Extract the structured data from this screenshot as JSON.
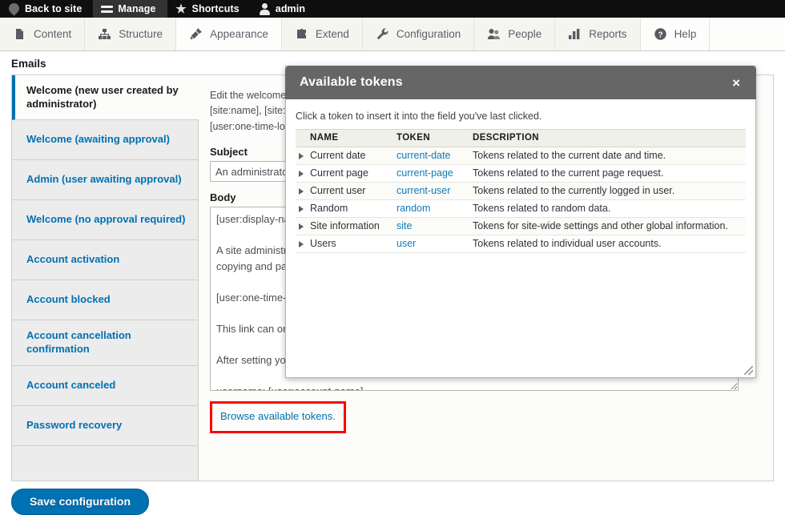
{
  "toolbar": {
    "items": [
      {
        "label": "Back to site",
        "icon": "drupal-icon",
        "active": false
      },
      {
        "label": "Manage",
        "icon": "hamburger-icon",
        "active": true
      },
      {
        "label": "Shortcuts",
        "icon": "star-icon",
        "active": false
      },
      {
        "label": "admin",
        "icon": "person-icon",
        "active": false
      }
    ]
  },
  "admin_menu": {
    "items": [
      {
        "label": "Content",
        "icon": "file-icon"
      },
      {
        "label": "Structure",
        "icon": "sitemap-icon"
      },
      {
        "label": "Appearance",
        "icon": "paintbrush-icon"
      },
      {
        "label": "Extend",
        "icon": "puzzle-icon"
      },
      {
        "label": "Configuration",
        "icon": "wrench-icon"
      },
      {
        "label": "People",
        "icon": "people-icon"
      },
      {
        "label": "Reports",
        "icon": "bar-chart-icon"
      },
      {
        "label": "Help",
        "icon": "question-circle-icon"
      }
    ]
  },
  "page": {
    "heading": "Emails",
    "save_label": "Save configuration"
  },
  "vertical_tabs": [
    {
      "label": "Welcome (new user created by administrator)",
      "selected": true
    },
    {
      "label": "Welcome (awaiting approval)",
      "selected": false
    },
    {
      "label": "Admin (user awaiting approval)",
      "selected": false
    },
    {
      "label": "Welcome (no approval required)",
      "selected": false
    },
    {
      "label": "Account activation",
      "selected": false
    },
    {
      "label": "Account blocked",
      "selected": false
    },
    {
      "label": "Account cancellation confirmation",
      "selected": false
    },
    {
      "label": "Account canceled",
      "selected": false
    },
    {
      "label": "Password recovery",
      "selected": false
    }
  ],
  "form": {
    "description": "Edit the welcome e-mail messages sent to new member accounts created by an administrator. Available variables are: [site:name], [site:url], [user:display-name], [user:account-name], [user:mail], [site:login-url], [site:url-brief], [user:edit-url], [user:one-time-login-url], [user:cancel-url]. The list of available tokens that can be used in e-mails is provided below.",
    "subject_label": "Subject",
    "subject_value": "An administrator created an account for you at [site:name]",
    "body_label": "Body",
    "body_value": "[user:display-name],\n\nA site administrator at [site:name] has created an account for you. You may now log in by clicking this link or copying and pasting it into your browser:\n\n[user:one-time-login-url]\n\nThis link can only be used once to log in and will lead you to a page where you can set your password.\n\nAfter setting your password, you will be able to log in at [site:login-url] in the future using:\n\nusername: [user:account-name]\npassword: Your password\n\n--  [site:name] team",
    "token_link_label": "Browse available tokens."
  },
  "dialog": {
    "title": "Available tokens",
    "close_label": "×",
    "hint": "Click a token to insert it into the field you've last clicked.",
    "columns": [
      "NAME",
      "TOKEN",
      "DESCRIPTION"
    ],
    "rows": [
      {
        "name": "Current date",
        "token": "current-date",
        "description": "Tokens related to the current date and time."
      },
      {
        "name": "Current page",
        "token": "current-page",
        "description": "Tokens related to the current page request."
      },
      {
        "name": "Current user",
        "token": "current-user",
        "description": "Tokens related to the currently logged in user."
      },
      {
        "name": "Random",
        "token": "random",
        "description": "Tokens related to random data."
      },
      {
        "name": "Site information",
        "token": "site",
        "description": "Tokens for site-wide settings and other global information."
      },
      {
        "name": "Users",
        "token": "user",
        "description": "Tokens related to individual user accounts."
      }
    ]
  },
  "colors": {
    "toolbar_bg": "#0f0f0f",
    "toolbar_active": "#333333",
    "link_blue": "#0071b3",
    "dialog_header": "#666666",
    "highlight_red": "#ff0000",
    "button_blue": "#0071b3"
  }
}
